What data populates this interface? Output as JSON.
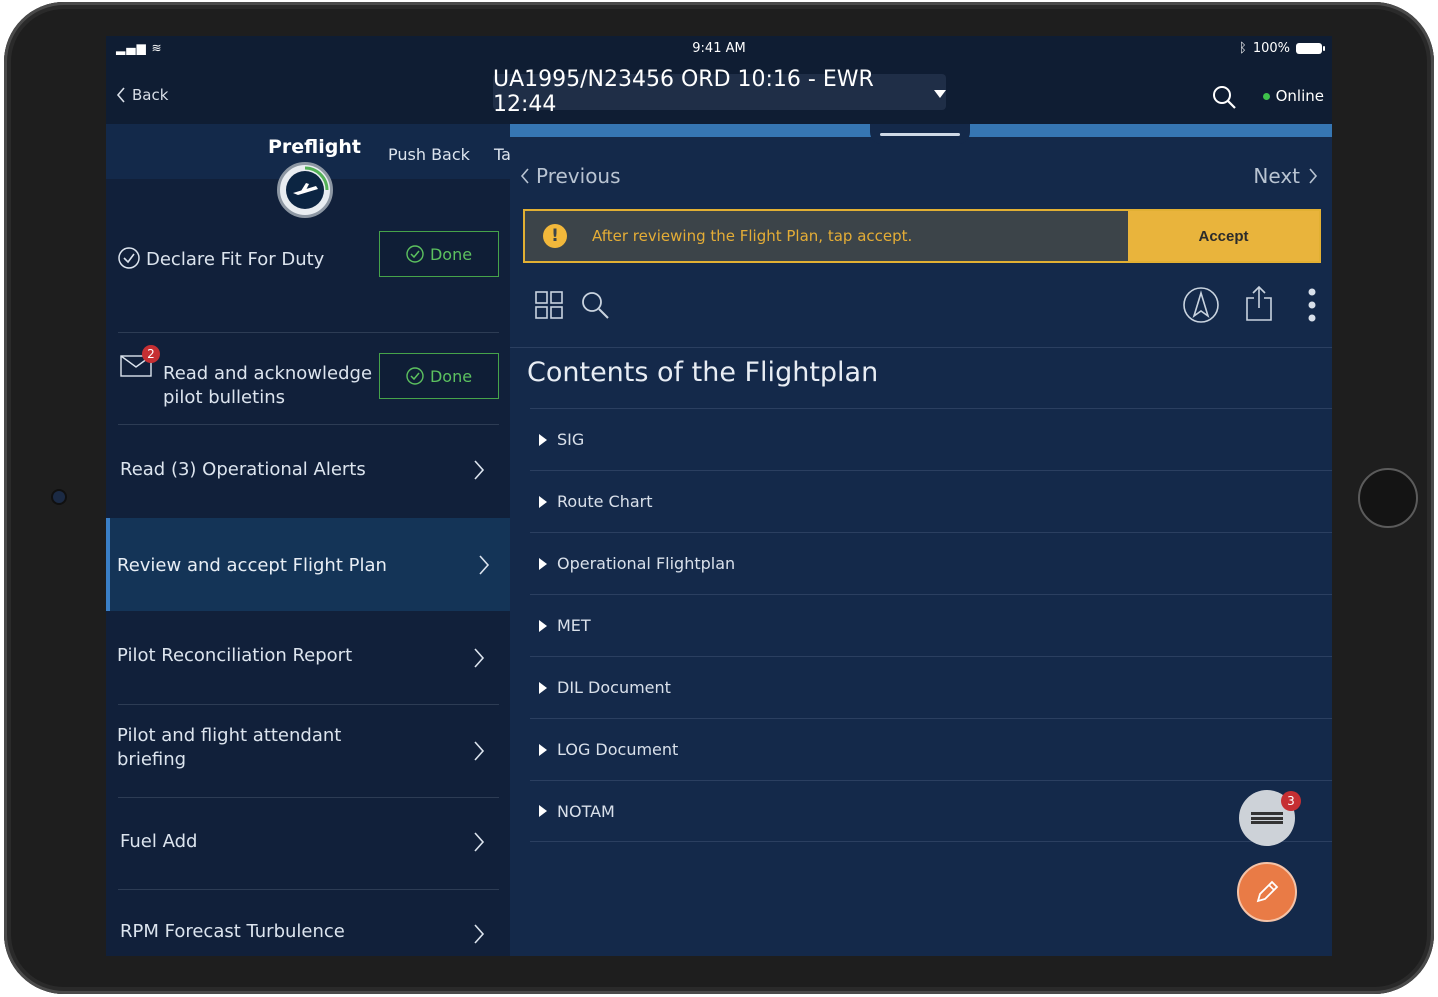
{
  "status_bar": {
    "time": "9:41 AM",
    "battery": "100%"
  },
  "nav": {
    "back_label": "Back",
    "flight_title": "UA1995/N23456 ORD 10:16 - EWR 12:44",
    "online_label": "Online"
  },
  "tabs": {
    "preflight": "Preflight",
    "push_back": "Push Back",
    "taxi": "Ta"
  },
  "tasks": {
    "declare_fit": "Declare Fit For Duty",
    "done_label": "Done",
    "bulletins_line1": "Read and acknowledge",
    "bulletins_line2": "pilot bulletins",
    "bulletins_badge": "2",
    "alerts": "Read (3) Operational Alerts",
    "review_flight_plan": "Review and accept Flight Plan",
    "pilot_reconciliation": "Pilot Reconciliation Report",
    "briefing_line1": "Pilot and flight attendant",
    "briefing_line2": "briefing",
    "fuel_add": "Fuel Add",
    "rpm_forecast": "RPM Forecast Turbulence"
  },
  "document": {
    "previous_label": "Previous",
    "next_label": "Next",
    "alert_text": "After reviewing  the Flight Plan,  tap accept.",
    "accept_label": "Accept",
    "title": "Contents of the Flightplan",
    "sections": [
      "SIG",
      "Route Chart",
      "Operational Flightplan",
      "MET",
      "DIL Document",
      "LOG Document",
      "NOTAM"
    ]
  },
  "fab": {
    "list_badge": "3"
  },
  "colors": {
    "screen_bg": "#0f1d33",
    "accent_blue": "#3676b3",
    "alert_yellow": "#e9b43c",
    "done_green": "#46a34a",
    "fab_orange": "#e97b46",
    "badge_red": "#c62f33"
  },
  "icons": [
    "back-chevron-icon",
    "dropdown-caret-icon",
    "search-icon",
    "online-dot-icon",
    "plane-icon",
    "check-circle-icon",
    "envelope-icon",
    "chevron-right-icon",
    "chevron-left-icon",
    "warning-icon",
    "grid-icon",
    "navigation-icon",
    "share-icon",
    "more-vertical-icon",
    "list-icon",
    "pencil-icon"
  ]
}
